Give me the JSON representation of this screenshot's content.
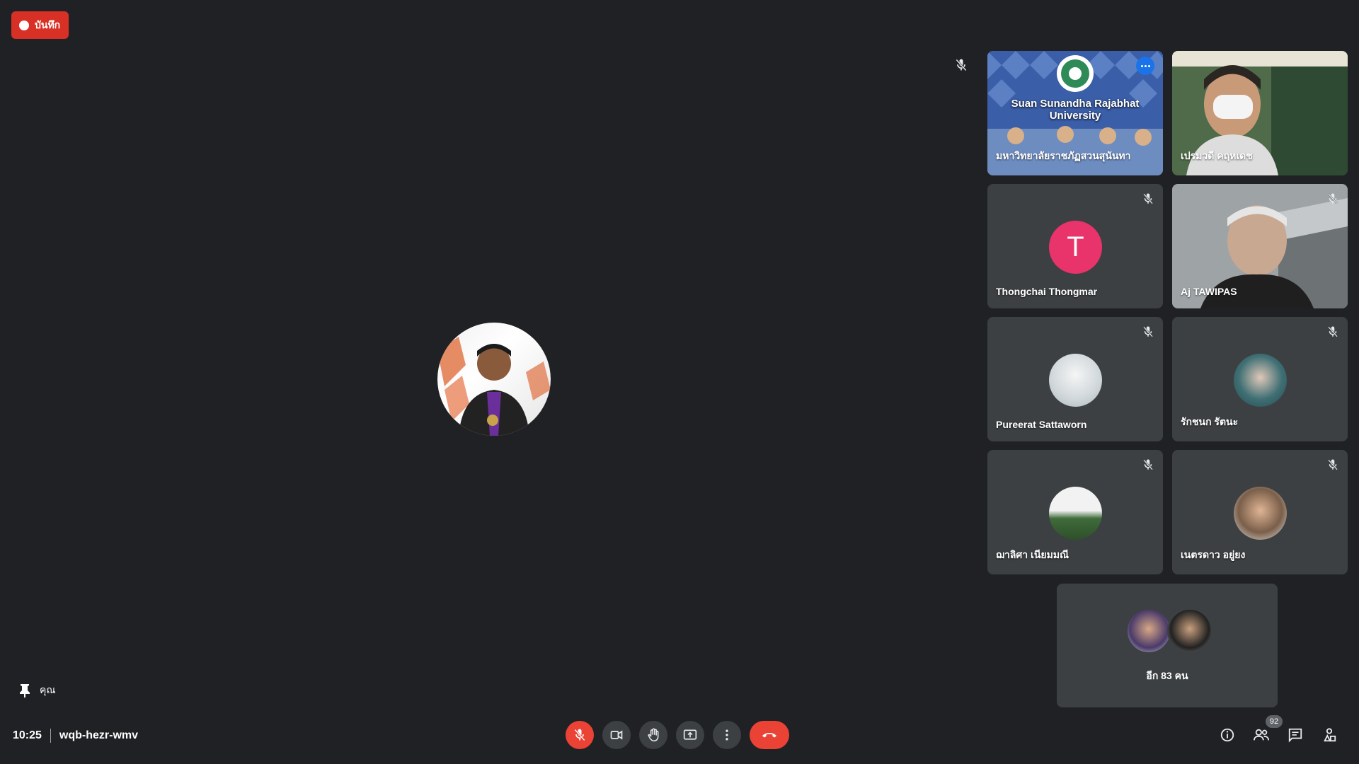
{
  "recording": {
    "label": "บันทึก"
  },
  "self": {
    "name": "คุณ"
  },
  "meeting": {
    "time": "10:25",
    "code": "wqb-hezr-wmv",
    "people_count": "92"
  },
  "participants": [
    {
      "name": "มหาวิทยาลัยราชภัฏสวนสุนันทา",
      "type": "video",
      "overlay_text": "Suan Sunandha Rajabhat University"
    },
    {
      "name": "เปรมวดี คฤหเดช",
      "type": "video"
    },
    {
      "name": "Thongchai Thongmar",
      "type": "letter",
      "letter": "T"
    },
    {
      "name": "Aj TAWIPAS",
      "type": "video"
    },
    {
      "name": "Pureerat Sattaworn",
      "type": "photo"
    },
    {
      "name": "รักชนก รัตนะ",
      "type": "photo"
    },
    {
      "name": "ฌาลิศา เนียมมณี",
      "type": "photo"
    },
    {
      "name": "เนตรดาว อยู่ยง",
      "type": "photo"
    }
  ],
  "others": {
    "label": "อีก 83 คน"
  },
  "colors": {
    "background": "#202124",
    "tile": "#3c4043",
    "red": "#ea4335",
    "accent": "#1a73e8",
    "letter_avatar": "#e8336b"
  },
  "icons": [
    "mic-off-icon",
    "camera-icon",
    "raise-hand-icon",
    "present-icon",
    "more-options-icon",
    "end-call-icon",
    "info-icon",
    "people-icon",
    "chat-icon",
    "activities-icon",
    "pin-icon"
  ]
}
